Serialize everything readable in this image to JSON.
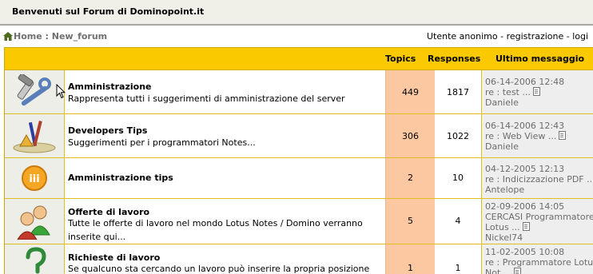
{
  "header": {
    "title": "Benvenuti sul Forum di Dominopoint.it"
  },
  "breadcrumb": {
    "home": "Home",
    "separator": " : ",
    "current": "New_forum"
  },
  "user_nav": {
    "text": "Utente anonimo",
    "sep1": " - ",
    "register": "registrazione",
    "sep2": " - ",
    "login": "logi"
  },
  "table": {
    "headers": {
      "topics": "Topics",
      "responses": "Responses",
      "last": "Ultimo messaggio"
    },
    "rows": [
      {
        "icon": "tools-icon",
        "name": "Amministrazione",
        "desc": "Rappresenta tutti i suggerimenti di amministrazione del server",
        "topics": "449",
        "responses": "1817",
        "last_date": "06-14-2006 12:48",
        "last_title": "re : test ...",
        "last_author": "Daniele"
      },
      {
        "icon": "pencils-icon",
        "name": "Developers Tips",
        "desc": "Suggerimenti per i programmatori Notes...",
        "topics": "306",
        "responses": "1022",
        "last_date": "06-14-2006 12:43",
        "last_title": "re : Web View ...",
        "last_author": "Daniele"
      },
      {
        "icon": "server-tips-icon",
        "name": "Amministrazione tips",
        "desc": "",
        "topics": "2",
        "responses": "10",
        "last_date": "04-12-2005 12:13",
        "last_title": "re : Indicizzazione PDF ...",
        "last_author": "Antelope"
      },
      {
        "icon": "people-icon",
        "name": "Offerte di lavoro",
        "desc": "Tutte le offerte di lavoro nel mondo Lotus Notes / Domino verranno inserite qui...",
        "topics": "5",
        "responses": "4",
        "last_date": "02-09-2006 14:05",
        "last_title": "CERCASI Programmatore",
        "last_title2": "Lotus ...",
        "last_author": "Nickel74"
      },
      {
        "icon": "help-icon",
        "name": "Richieste di lavoro",
        "desc": "Se qualcuno sta cercando un lavoro può inserire la propria posizione",
        "topics": "1",
        "responses": "1",
        "last_date": "11-02-2005 10:08",
        "last_title": "re : Programmatore Lotus",
        "last_title2": "Not ..."
      }
    ]
  },
  "colors": {
    "header_bg": "#fbc900",
    "topics_bg": "#fbc8a2",
    "icon_bg": "#eeeee8",
    "border": "#e2bd20"
  }
}
